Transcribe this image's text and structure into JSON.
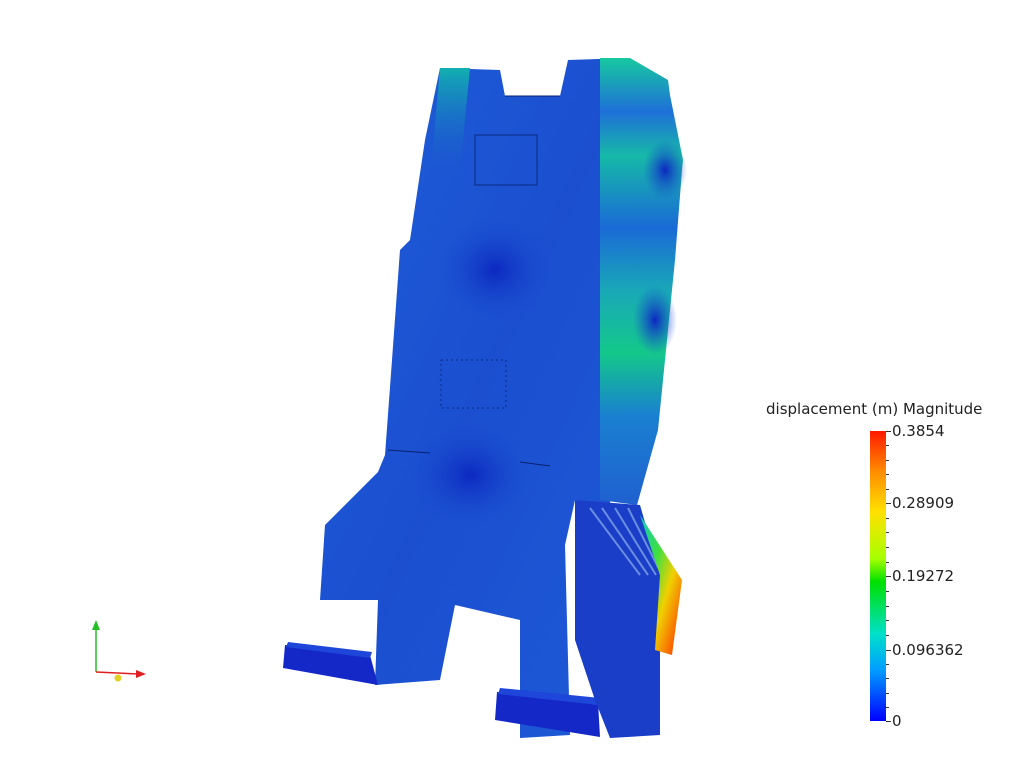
{
  "colorbar": {
    "title": "displacement (m) Magnitude",
    "ticks": [
      "0.3854",
      "0.28909",
      "0.19272",
      "0.096362",
      "0"
    ]
  },
  "colors": {
    "background": "#ffffff",
    "model_base": "#1a4fc8",
    "model_mid": "#0a6adf",
    "max_displacement": "#ff2000"
  },
  "icons": {
    "orientation_axes": "xyz-axes-icon"
  }
}
